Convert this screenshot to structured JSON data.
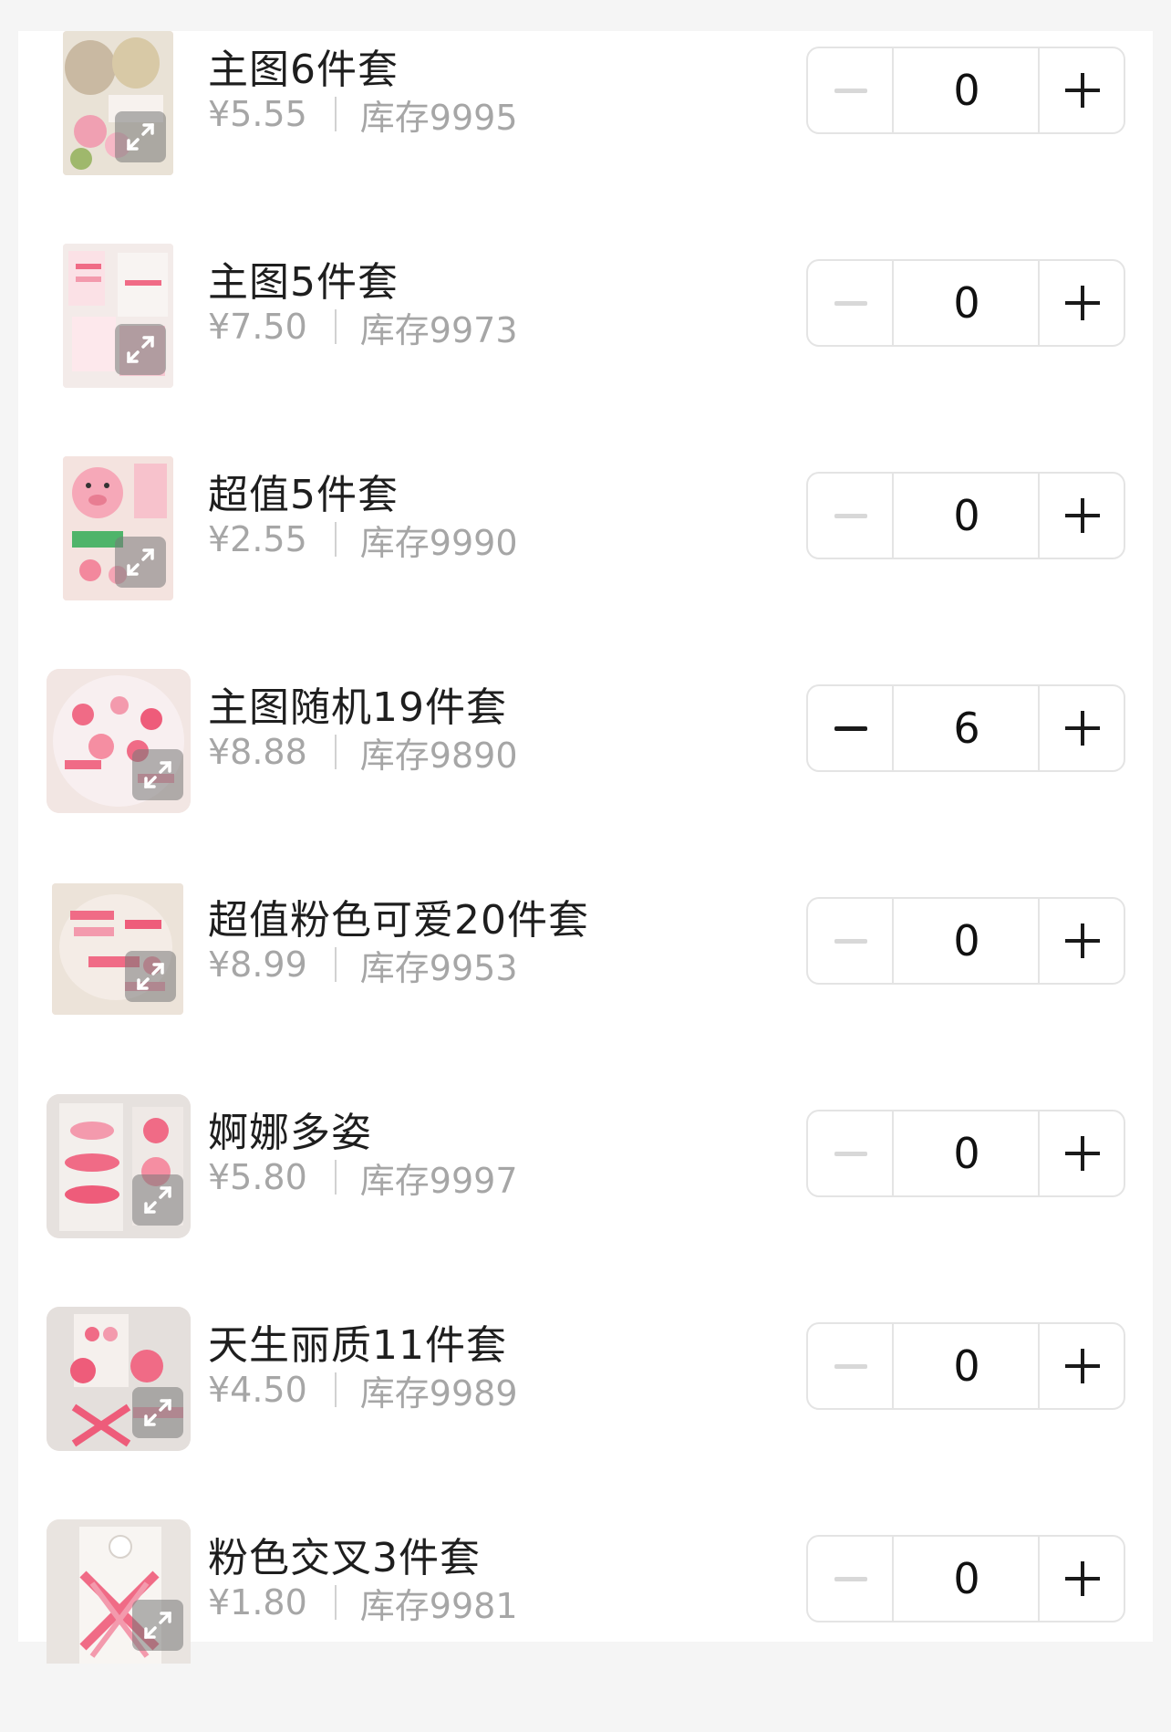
{
  "items": [
    {
      "name": "主图6件套",
      "price": "¥5.55",
      "stock": "库存9995",
      "qty": "0",
      "minus_enabled": false
    },
    {
      "name": "主图5件套",
      "price": "¥7.50",
      "stock": "库存9973",
      "qty": "0",
      "minus_enabled": false
    },
    {
      "name": "超值5件套",
      "price": "¥2.55",
      "stock": "库存9990",
      "qty": "0",
      "minus_enabled": false
    },
    {
      "name": "主图随机19件套",
      "price": "¥8.88",
      "stock": "库存9890",
      "qty": "6",
      "minus_enabled": true
    },
    {
      "name": "超值粉色可爱20件套",
      "price": "¥8.99",
      "stock": "库存9953",
      "qty": "0",
      "minus_enabled": false
    },
    {
      "name": "婀娜多姿",
      "price": "¥5.80",
      "stock": "库存9997",
      "qty": "0",
      "minus_enabled": false
    },
    {
      "name": "天生丽质11件套",
      "price": "¥4.50",
      "stock": "库存9989",
      "qty": "0",
      "minus_enabled": false
    },
    {
      "name": "粉色交叉3件套",
      "price": "¥1.80",
      "stock": "库存9981",
      "qty": "0",
      "minus_enabled": false
    }
  ],
  "icons": {
    "thumbnail_overlay": "expand-icon",
    "decrease": "minus-icon",
    "increase": "plus-icon"
  },
  "colors": {
    "product_pink": "#f06b86",
    "disabled_minus": "#d8d8d8",
    "price_text": "#a6a6a6"
  }
}
